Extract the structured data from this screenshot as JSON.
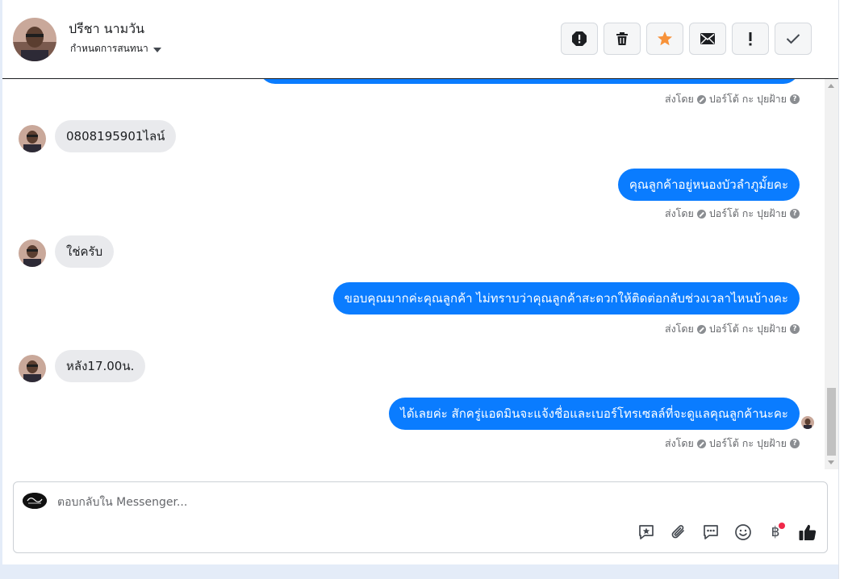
{
  "header": {
    "contact_name": "ปรีชา นามวัน",
    "assign_label": "กำหนดการสนทนา",
    "actions": [
      "spam-icon",
      "trash-icon",
      "star-icon",
      "mail-icon",
      "important-icon",
      "check-icon"
    ]
  },
  "messages": [
    {
      "direction": "outgoing",
      "text": "",
      "sent_by": "ส่งโดย",
      "sender": "ปอร์โต้ กะ ปุยฝ้าย"
    },
    {
      "direction": "incoming",
      "text": "0808195901ไลน์"
    },
    {
      "direction": "outgoing",
      "text": "คุณลูกค้าอยู่หนองบัวลำภูมั้ยคะ",
      "sent_by": "ส่งโดย",
      "sender": "ปอร์โต้ กะ ปุยฝ้าย"
    },
    {
      "direction": "incoming",
      "text": "ใช่ครับ"
    },
    {
      "direction": "outgoing",
      "text": "ขอบคุณมากค่ะคุณลูกค้า ไม่ทราบว่าคุณลูกค้าสะดวกให้ติดต่อกลับช่วงเวลาไหนบ้างคะ",
      "sent_by": "ส่งโดย",
      "sender": "ปอร์โต้ กะ ปุยฝ้าย"
    },
    {
      "direction": "incoming",
      "text": "หลัง17.00น."
    },
    {
      "direction": "outgoing",
      "text": "ได้เลยค่ะ สักครู่แอดมินจะแจ้งชื่อและเบอร์โทรเซลล์ที่จะดูแลคุณลูกค้านะคะ",
      "sent_by": "ส่งโดย",
      "sender": "ปอร์โต้ กะ ปุยฝ้าย"
    }
  ],
  "composer": {
    "placeholder": "ตอบกลับใน Messenger...",
    "tools": [
      "saved-reply-icon",
      "attach-icon",
      "chat-icon",
      "emoji-icon",
      "baht-icon",
      "like-icon"
    ],
    "baht_symbol": "฿"
  },
  "colors": {
    "outgoing_bubble": "#0a7cff",
    "incoming_bubble": "#e9eaed",
    "star": "#f7923a",
    "notification_dot": "#f02849"
  }
}
